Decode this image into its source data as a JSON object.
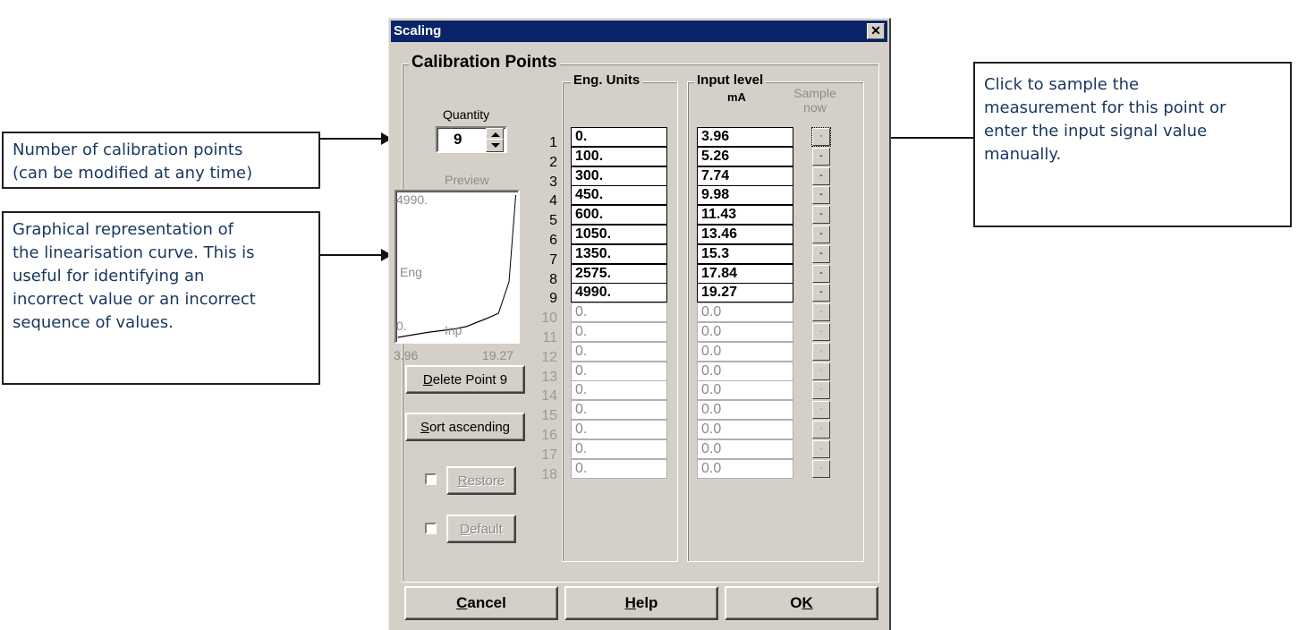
{
  "callouts": {
    "quantity": [
      "Number of calibration points",
      "(can be modified at any time)"
    ],
    "preview": [
      "Graphical representation of",
      "the linearisation curve. This is",
      "useful for identifying an",
      "incorrect value or an incorrect",
      "sequence of values."
    ],
    "sample": [
      "Click to sample the",
      "measurement for this point or",
      "enter the input signal value",
      "manually."
    ]
  },
  "dialog": {
    "title": "Scaling",
    "close_glyph": "✕",
    "group_title": "Calibration Points",
    "quantity_label": "Quantity",
    "quantity_value": "9",
    "preview_label": "Preview",
    "preview": {
      "y_max": "4990.",
      "y_min": "0.",
      "y_label": "Eng",
      "x_label": "Inp",
      "x_min": "3.96",
      "x_max": "19.27"
    },
    "eng_units_title": "Eng. Units",
    "input_level_title": "Input level",
    "input_unit": "mA",
    "sample_now": "Sample now",
    "buttons": {
      "delete_prefix": "D",
      "delete_rest": "elete Point 9",
      "sort_prefix": "S",
      "sort_rest": "ort ascending",
      "restore_prefix": "R",
      "restore_rest": "estore",
      "default_prefix": "D",
      "default_rest": "efault",
      "cancel_prefix": "C",
      "cancel_rest": "ancel",
      "help_prefix": "H",
      "help_rest": "elp",
      "ok_main": "O",
      "ok_acc": "K"
    },
    "sample_glyph_active": "·",
    "sample_glyph": "-"
  },
  "rows": [
    {
      "num": "1",
      "eng": "0.",
      "inp": "3.96",
      "active": true
    },
    {
      "num": "2",
      "eng": "100.",
      "inp": "5.26",
      "active": true
    },
    {
      "num": "3",
      "eng": "300.",
      "inp": "7.74",
      "active": true
    },
    {
      "num": "4",
      "eng": "450.",
      "inp": "9.98",
      "active": true
    },
    {
      "num": "5",
      "eng": "600.",
      "inp": "11.43",
      "active": true
    },
    {
      "num": "6",
      "eng": "1050.",
      "inp": "13.46",
      "active": true
    },
    {
      "num": "7",
      "eng": "1350.",
      "inp": "15.3",
      "active": true
    },
    {
      "num": "8",
      "eng": "2575.",
      "inp": "17.84",
      "active": true
    },
    {
      "num": "9",
      "eng": "4990.",
      "inp": "19.27",
      "active": true
    },
    {
      "num": "10",
      "eng": "0.",
      "inp": "0.0",
      "active": false
    },
    {
      "num": "11",
      "eng": "0.",
      "inp": "0.0",
      "active": false
    },
    {
      "num": "12",
      "eng": "0.",
      "inp": "0.0",
      "active": false
    },
    {
      "num": "13",
      "eng": "0.",
      "inp": "0.0",
      "active": false
    },
    {
      "num": "14",
      "eng": "0.",
      "inp": "0.0",
      "active": false
    },
    {
      "num": "15",
      "eng": "0.",
      "inp": "0.0",
      "active": false
    },
    {
      "num": "16",
      "eng": "0.",
      "inp": "0.0",
      "active": false
    },
    {
      "num": "17",
      "eng": "0.",
      "inp": "0.0",
      "active": false
    },
    {
      "num": "18",
      "eng": "0.",
      "inp": "0.0",
      "active": false
    }
  ]
}
